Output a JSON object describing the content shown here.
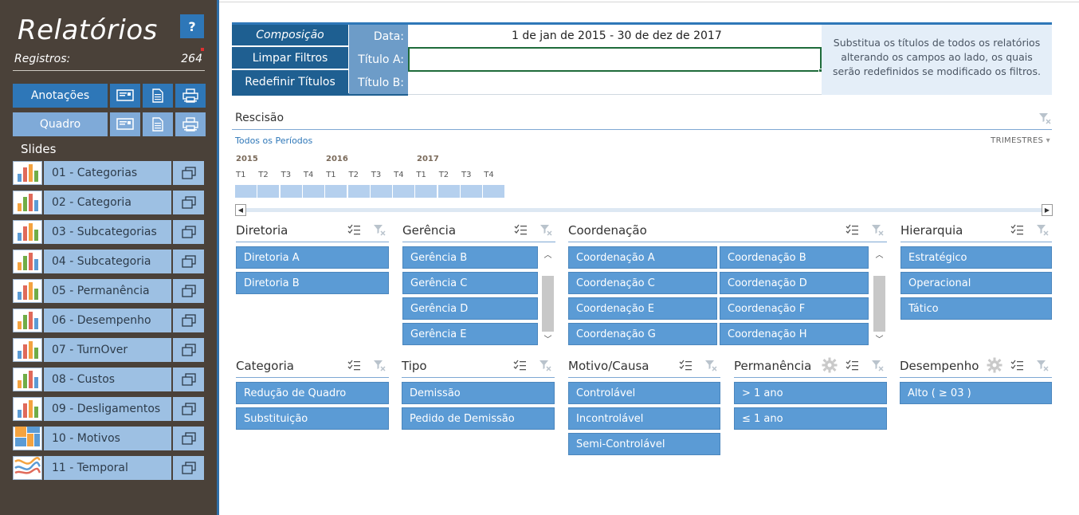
{
  "sidebar": {
    "title": "Relatórios",
    "help_label": "?",
    "registros_label": "Registros:",
    "registros_count": "264",
    "anotacoes_label": "Anotações",
    "quadro_label": "Quadro",
    "slides_label": "Slides",
    "slides": [
      {
        "label": "01 - Categorias",
        "thumb": "bar-chart-icon"
      },
      {
        "label": "02 - Categoria",
        "thumb": "bar-chart-icon"
      },
      {
        "label": "03 - Subcategorias",
        "thumb": "bar-chart-icon"
      },
      {
        "label": "04 - Subcategoria",
        "thumb": "bar-chart-icon"
      },
      {
        "label": "05 - Permanência",
        "thumb": "bar-chart-icon"
      },
      {
        "label": "06 - Desempenho",
        "thumb": "bar-chart-icon"
      },
      {
        "label": "07 - TurnOver",
        "thumb": "bar-chart-icon"
      },
      {
        "label": "08 - Custos",
        "thumb": "bar-chart-icon"
      },
      {
        "label": "09 - Desligamentos",
        "thumb": "bar-chart-icon"
      },
      {
        "label": "10 - Motivos",
        "thumb": "treemap-icon"
      },
      {
        "label": "11 - Temporal",
        "thumb": "line-chart-icon"
      }
    ]
  },
  "header": {
    "composicao_label": "Composição",
    "limpar_label": "Limpar Filtros",
    "redefinir_label": "Redefinir Títulos",
    "data_label": "Data:",
    "data_value": "1 de jan de 2015 - 30 de dez de 2017",
    "titulo_a_label": "Título A:",
    "titulo_a_value": "",
    "titulo_b_label": "Título B:",
    "titulo_b_value": "",
    "note": "Substitua os títulos de todos os relatórios alterando os campos ao lado, os quais serão redefinidos se modificado os filtros."
  },
  "timeline": {
    "title": "Rescisão",
    "all_periods": "Todos os Períodos",
    "level": "TRIMESTRES",
    "years": [
      "2015",
      "2016",
      "2017"
    ],
    "quarters": [
      "T1",
      "T2",
      "T3",
      "T4",
      "T1",
      "T2",
      "T3",
      "T4",
      "T1",
      "T2",
      "T3",
      "T4"
    ]
  },
  "slicers": {
    "diretoria": {
      "title": "Diretoria",
      "items": [
        "Diretoria A",
        "Diretoria B"
      ]
    },
    "gerencia": {
      "title": "Gerência",
      "items": [
        "Gerência B",
        "Gerência C",
        "Gerência D",
        "Gerência E"
      ]
    },
    "coordenacao": {
      "title": "Coordenação",
      "items": [
        "Coordenação A",
        "Coordenação B",
        "Coordenação C",
        "Coordenação D",
        "Coordenação E",
        "Coordenação F",
        "Coordenação G",
        "Coordenação H"
      ]
    },
    "hierarquia": {
      "title": "Hierarquia",
      "items": [
        "Estratégico",
        "Operacional",
        "Tático"
      ]
    },
    "categoria": {
      "title": "Categoria",
      "items": [
        "Redução de Quadro",
        "Substituição"
      ]
    },
    "tipo": {
      "title": "Tipo",
      "items": [
        "Demissão",
        "Pedido de Demissão"
      ]
    },
    "motivo": {
      "title": "Motivo/Causa",
      "items": [
        "Controlável",
        "Incontrolável",
        "Semi-Controlável"
      ]
    },
    "permanencia": {
      "title": "Permanência",
      "items": [
        "> 1 ano",
        "≤ 1 ano"
      ]
    },
    "desempenho": {
      "title": "Desempenho",
      "items": [
        "Alto ( ≥ 03 )"
      ]
    }
  },
  "colors": {
    "sidebar_bg": "#4a4139",
    "accent_blue": "#2e77b8",
    "slicer_item": "#5b9bd5",
    "slide_item": "#9dc0e3"
  }
}
